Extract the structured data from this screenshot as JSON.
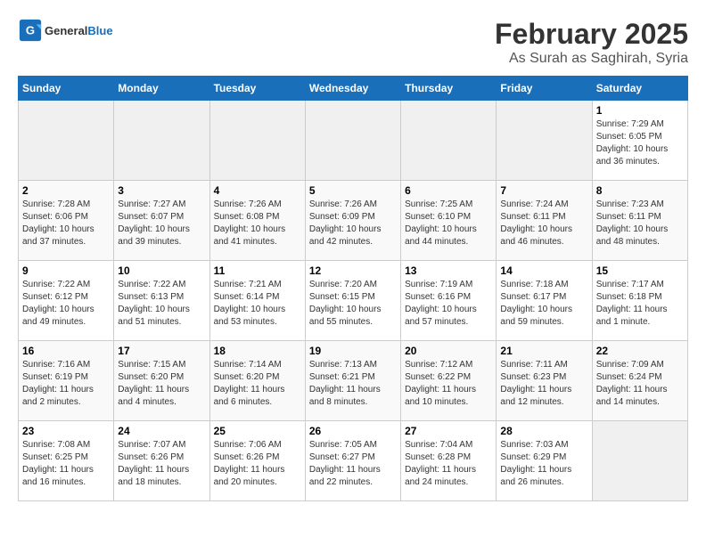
{
  "header": {
    "logo_text_general": "General",
    "logo_text_blue": "Blue",
    "title": "February 2025",
    "subtitle": "As Surah as Saghirah, Syria"
  },
  "days_of_week": [
    "Sunday",
    "Monday",
    "Tuesday",
    "Wednesday",
    "Thursday",
    "Friday",
    "Saturday"
  ],
  "weeks": [
    [
      {
        "day": "",
        "info": ""
      },
      {
        "day": "",
        "info": ""
      },
      {
        "day": "",
        "info": ""
      },
      {
        "day": "",
        "info": ""
      },
      {
        "day": "",
        "info": ""
      },
      {
        "day": "",
        "info": ""
      },
      {
        "day": "1",
        "info": "Sunrise: 7:29 AM\nSunset: 6:05 PM\nDaylight: 10 hours and 36 minutes."
      }
    ],
    [
      {
        "day": "2",
        "info": "Sunrise: 7:28 AM\nSunset: 6:06 PM\nDaylight: 10 hours and 37 minutes."
      },
      {
        "day": "3",
        "info": "Sunrise: 7:27 AM\nSunset: 6:07 PM\nDaylight: 10 hours and 39 minutes."
      },
      {
        "day": "4",
        "info": "Sunrise: 7:26 AM\nSunset: 6:08 PM\nDaylight: 10 hours and 41 minutes."
      },
      {
        "day": "5",
        "info": "Sunrise: 7:26 AM\nSunset: 6:09 PM\nDaylight: 10 hours and 42 minutes."
      },
      {
        "day": "6",
        "info": "Sunrise: 7:25 AM\nSunset: 6:10 PM\nDaylight: 10 hours and 44 minutes."
      },
      {
        "day": "7",
        "info": "Sunrise: 7:24 AM\nSunset: 6:11 PM\nDaylight: 10 hours and 46 minutes."
      },
      {
        "day": "8",
        "info": "Sunrise: 7:23 AM\nSunset: 6:11 PM\nDaylight: 10 hours and 48 minutes."
      }
    ],
    [
      {
        "day": "9",
        "info": "Sunrise: 7:22 AM\nSunset: 6:12 PM\nDaylight: 10 hours and 49 minutes."
      },
      {
        "day": "10",
        "info": "Sunrise: 7:22 AM\nSunset: 6:13 PM\nDaylight: 10 hours and 51 minutes."
      },
      {
        "day": "11",
        "info": "Sunrise: 7:21 AM\nSunset: 6:14 PM\nDaylight: 10 hours and 53 minutes."
      },
      {
        "day": "12",
        "info": "Sunrise: 7:20 AM\nSunset: 6:15 PM\nDaylight: 10 hours and 55 minutes."
      },
      {
        "day": "13",
        "info": "Sunrise: 7:19 AM\nSunset: 6:16 PM\nDaylight: 10 hours and 57 minutes."
      },
      {
        "day": "14",
        "info": "Sunrise: 7:18 AM\nSunset: 6:17 PM\nDaylight: 10 hours and 59 minutes."
      },
      {
        "day": "15",
        "info": "Sunrise: 7:17 AM\nSunset: 6:18 PM\nDaylight: 11 hours and 1 minute."
      }
    ],
    [
      {
        "day": "16",
        "info": "Sunrise: 7:16 AM\nSunset: 6:19 PM\nDaylight: 11 hours and 2 minutes."
      },
      {
        "day": "17",
        "info": "Sunrise: 7:15 AM\nSunset: 6:20 PM\nDaylight: 11 hours and 4 minutes."
      },
      {
        "day": "18",
        "info": "Sunrise: 7:14 AM\nSunset: 6:20 PM\nDaylight: 11 hours and 6 minutes."
      },
      {
        "day": "19",
        "info": "Sunrise: 7:13 AM\nSunset: 6:21 PM\nDaylight: 11 hours and 8 minutes."
      },
      {
        "day": "20",
        "info": "Sunrise: 7:12 AM\nSunset: 6:22 PM\nDaylight: 11 hours and 10 minutes."
      },
      {
        "day": "21",
        "info": "Sunrise: 7:11 AM\nSunset: 6:23 PM\nDaylight: 11 hours and 12 minutes."
      },
      {
        "day": "22",
        "info": "Sunrise: 7:09 AM\nSunset: 6:24 PM\nDaylight: 11 hours and 14 minutes."
      }
    ],
    [
      {
        "day": "23",
        "info": "Sunrise: 7:08 AM\nSunset: 6:25 PM\nDaylight: 11 hours and 16 minutes."
      },
      {
        "day": "24",
        "info": "Sunrise: 7:07 AM\nSunset: 6:26 PM\nDaylight: 11 hours and 18 minutes."
      },
      {
        "day": "25",
        "info": "Sunrise: 7:06 AM\nSunset: 6:26 PM\nDaylight: 11 hours and 20 minutes."
      },
      {
        "day": "26",
        "info": "Sunrise: 7:05 AM\nSunset: 6:27 PM\nDaylight: 11 hours and 22 minutes."
      },
      {
        "day": "27",
        "info": "Sunrise: 7:04 AM\nSunset: 6:28 PM\nDaylight: 11 hours and 24 minutes."
      },
      {
        "day": "28",
        "info": "Sunrise: 7:03 AM\nSunset: 6:29 PM\nDaylight: 11 hours and 26 minutes."
      },
      {
        "day": "",
        "info": ""
      }
    ]
  ]
}
